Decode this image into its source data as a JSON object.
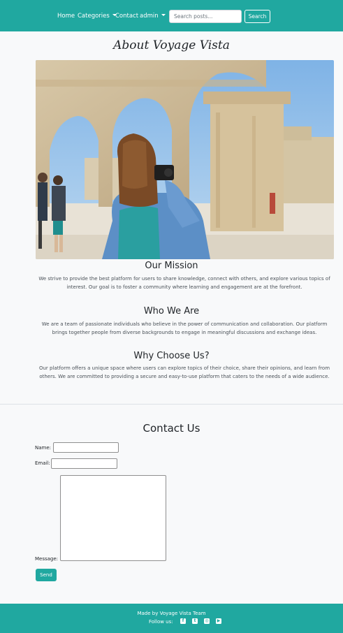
{
  "nav": {
    "home": "Home",
    "categories": "Categories",
    "contact": "Contact",
    "user": "admin",
    "search_placeholder": "Search posts...",
    "search_button": "Search"
  },
  "about": {
    "title": "About Voyage Vista",
    "hero_image": "woman-photographing-stone-arches"
  },
  "sections": [
    {
      "title": "Our Mission",
      "lines": [
        "We strive to provide the best platform for users to share knowledge, connect with others, and explore various topics of",
        "interest. Our goal is to foster a community where learning and engagement are at the forefront."
      ]
    },
    {
      "title": "Who We Are",
      "lines": [
        "We are a team of passionate individuals who believe in the power of communication and collaboration. Our platform",
        "brings together people from diverse backgrounds to engage in meaningful discussions and exchange ideas."
      ]
    },
    {
      "title": "Why Choose Us?",
      "lines": [
        "Our platform offers a unique space where users can explore topics of their choice, share their opinions, and learn from",
        "others. We are committed to providing a secure and easy-to-use platform that caters to the needs of a wide audience."
      ]
    }
  ],
  "contact": {
    "title": "Contact Us",
    "name_label": "Name:",
    "email_label": "Email:",
    "message_label": "Message:",
    "name_value": "",
    "email_value": "",
    "message_value": "",
    "send_button": "Send"
  },
  "footer": {
    "made_by": "Made by Voyage Vista Team",
    "follow": "Follow us:",
    "social_icons": [
      "facebook-icon",
      "twitter-icon",
      "instagram-icon",
      "youtube-icon"
    ]
  },
  "colors": {
    "brand": "#20a8a0",
    "background": "#f8f9fa"
  }
}
